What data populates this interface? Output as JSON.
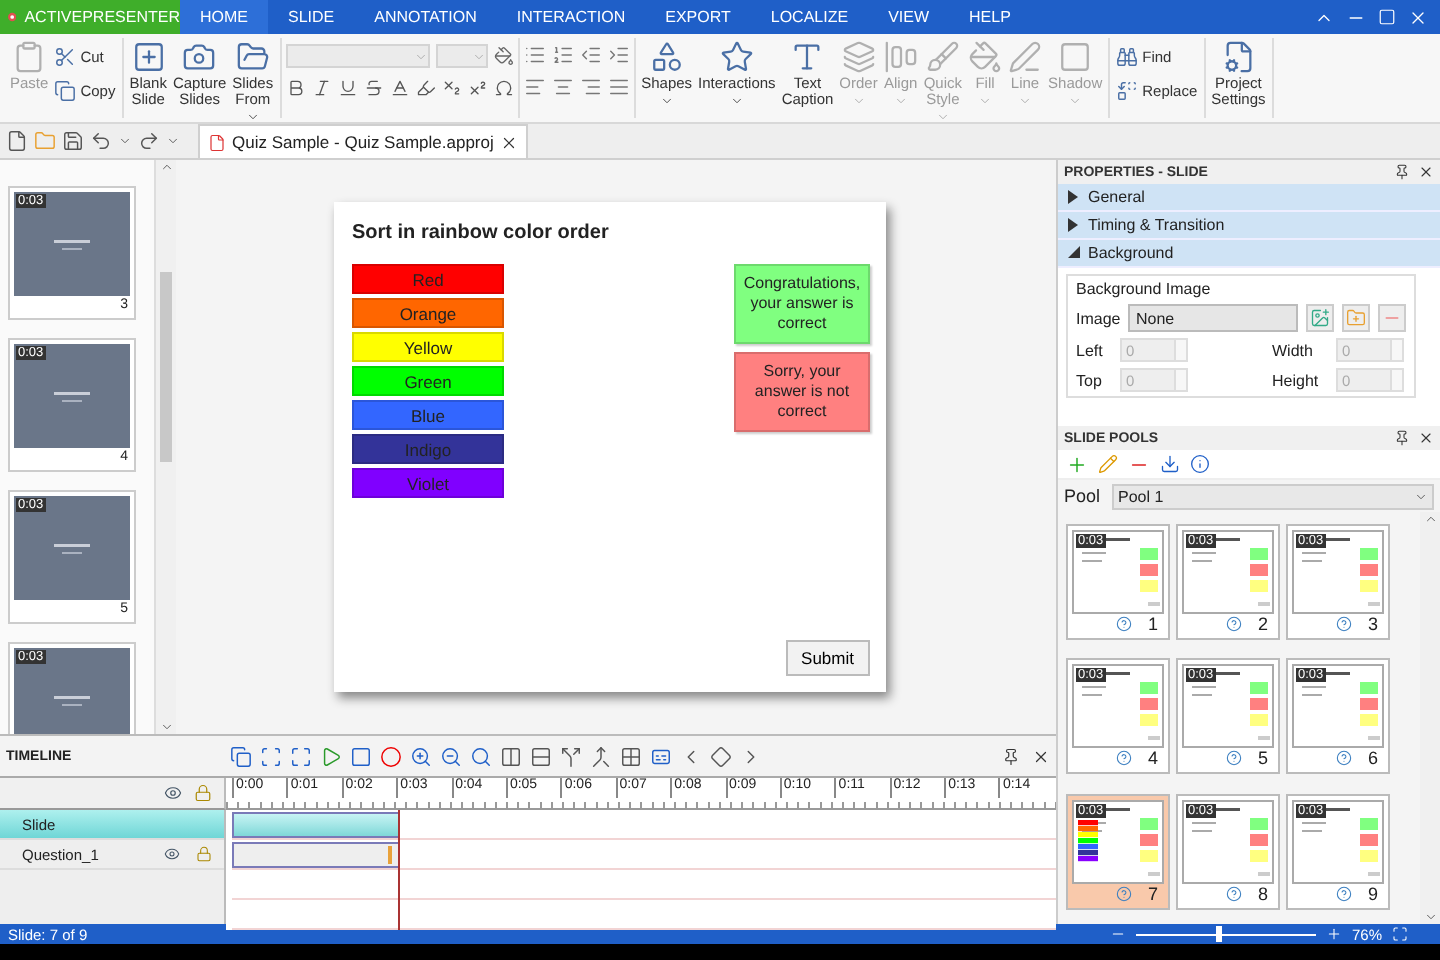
{
  "app_title": "ACTIVEPRESENTER",
  "menu_tabs": [
    {
      "label": "HOME",
      "selected": true
    },
    {
      "label": "SLIDE",
      "selected": false
    },
    {
      "label": "ANNOTATION",
      "selected": false
    },
    {
      "label": "INTERACTION",
      "selected": false
    },
    {
      "label": "EXPORT",
      "selected": false
    },
    {
      "label": "LOCALIZE",
      "selected": false
    },
    {
      "label": "VIEW",
      "selected": false
    },
    {
      "label": "HELP",
      "selected": false
    }
  ],
  "ribbon": [
    {
      "kind": "buttons",
      "items": [
        {
          "label": "Paste",
          "kind": "large",
          "disabled": true
        },
        {
          "label": "Cut",
          "kind": "small",
          "disabled": false
        },
        {
          "label": "Copy",
          "kind": "small",
          "disabled": false
        }
      ]
    },
    {
      "kind": "buttons",
      "items": [
        {
          "label": "Blank Slide",
          "kind": "large",
          "disabled": false
        },
        {
          "label": "Capture Slides",
          "kind": "large",
          "disabled": false
        },
        {
          "label": "Slides From",
          "kind": "large",
          "disabled": false,
          "dropdown": true
        }
      ]
    },
    {
      "kind": "font"
    },
    {
      "kind": "paragraph"
    },
    {
      "kind": "buttons",
      "items": [
        {
          "label": "Shapes",
          "kind": "large",
          "disabled": false,
          "dropdown": true
        },
        {
          "label": "Interactions",
          "kind": "large",
          "disabled": false,
          "dropdown": true
        },
        {
          "label": "Text Caption",
          "kind": "large",
          "disabled": false
        },
        {
          "label": "Order",
          "kind": "large",
          "disabled": true,
          "dropdown": true
        },
        {
          "label": "Align",
          "kind": "large",
          "disabled": true,
          "dropdown": true
        },
        {
          "label": "Quick Style",
          "kind": "large",
          "disabled": true,
          "dropdown": true
        },
        {
          "label": "Fill",
          "kind": "large",
          "disabled": true,
          "dropdown": true
        },
        {
          "label": "Line",
          "kind": "large",
          "disabled": true,
          "dropdown": true
        },
        {
          "label": "Shadow",
          "kind": "large",
          "disabled": true,
          "dropdown": true
        }
      ]
    },
    {
      "kind": "buttons",
      "items": [
        {
          "label": "Find",
          "kind": "small",
          "disabled": false
        },
        {
          "label": "Replace",
          "kind": "small",
          "disabled": false
        }
      ]
    },
    {
      "kind": "buttons",
      "items": [
        {
          "label": "Project Settings",
          "kind": "large",
          "disabled": false
        }
      ]
    }
  ],
  "document_tab": {
    "title": "Quiz Sample - Quiz Sample.approj"
  },
  "slide_thumbnails": [
    {
      "number": "3",
      "duration": "0:03"
    },
    {
      "number": "4",
      "duration": "0:03"
    },
    {
      "number": "5",
      "duration": "0:03"
    },
    {
      "duration": "0:03"
    }
  ],
  "slide": {
    "title": "Sort in rainbow color order",
    "items": [
      {
        "label": "Red",
        "color": "#ff0000"
      },
      {
        "label": "Orange",
        "color": "#ff6600"
      },
      {
        "label": "Yellow",
        "color": "#ffff00"
      },
      {
        "label": "Green",
        "color": "#00ff00"
      },
      {
        "label": "Blue",
        "color": "#3366ff"
      },
      {
        "label": "Indigo",
        "color": "#333399"
      },
      {
        "label": "Violet",
        "color": "#8000ff"
      }
    ],
    "feedback": [
      {
        "text": "Congratulations, your answer is correct",
        "color": "#80ff80"
      },
      {
        "text": "Sorry, your answer is not correct",
        "color": "#ff8080"
      }
    ],
    "submit": "Submit"
  },
  "properties": {
    "title": "PROPERTIES - SLIDE",
    "sections": [
      {
        "label": "General",
        "expanded": false
      },
      {
        "label": "Timing & Transition",
        "expanded": false
      },
      {
        "label": "Background",
        "expanded": true
      }
    ],
    "group_title": "Background Image",
    "image_label": "Image",
    "image_value": "None",
    "fields": [
      {
        "label": "Left",
        "value": "0"
      },
      {
        "label": "Width",
        "value": "0"
      },
      {
        "label": "Top",
        "value": "0"
      },
      {
        "label": "Height",
        "value": "0"
      }
    ]
  },
  "slide_pools": {
    "title": "SLIDE POOLS",
    "pool_label": "Pool",
    "pool_value": "Pool 1",
    "slides": [
      {
        "number": "1",
        "duration": "0:03",
        "selected": false
      },
      {
        "number": "2",
        "duration": "0:03",
        "selected": false
      },
      {
        "number": "3",
        "duration": "0:03",
        "selected": false
      },
      {
        "number": "4",
        "duration": "0:03",
        "selected": false
      },
      {
        "number": "5",
        "duration": "0:03",
        "selected": false
      },
      {
        "number": "6",
        "duration": "0:03",
        "selected": false
      },
      {
        "number": "7",
        "duration": "0:03",
        "selected": true
      },
      {
        "number": "8",
        "duration": "0:03",
        "selected": false
      },
      {
        "number": "9",
        "duration": "0:03",
        "selected": false
      }
    ]
  },
  "timeline": {
    "title": "TIMELINE",
    "ticks": [
      "0:00",
      "0:01",
      "0:02",
      "0:03",
      "0:04",
      "0:05",
      "0:06",
      "0:07",
      "0:08",
      "0:09",
      "0:10",
      "0:11",
      "0:12",
      "0:13",
      "0:14"
    ],
    "tracks": [
      {
        "name": "Slide",
        "selected": true
      },
      {
        "name": "Question_1",
        "selected": false
      }
    ]
  },
  "status_bar": {
    "text": "Slide: 7 of 9",
    "level": 0.45,
    "zoom": "76%"
  }
}
